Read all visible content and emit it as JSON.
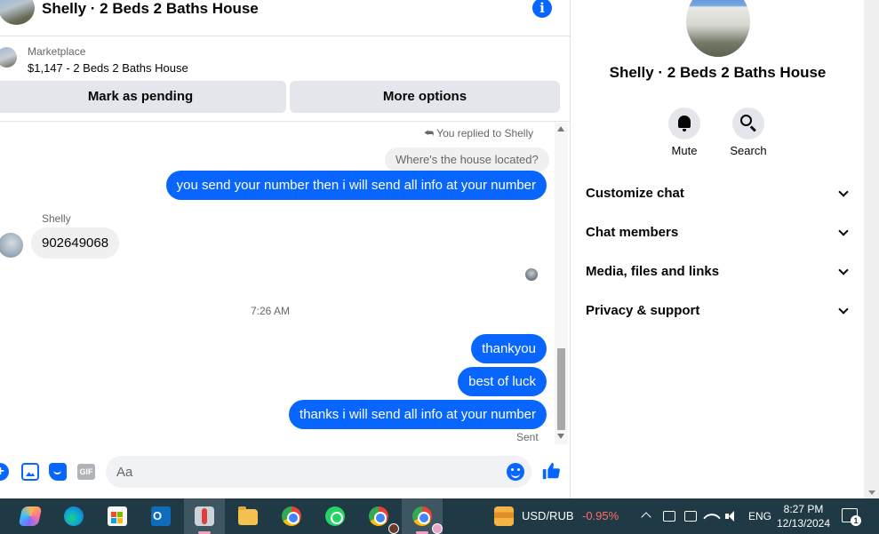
{
  "header": {
    "title": "Shelly · 2 Beds 2 Baths House"
  },
  "marketplace": {
    "label": "Marketplace",
    "listing": "$1,147 - 2 Beds 2 Baths House",
    "mark_pending": "Mark as pending",
    "more_options": "More options"
  },
  "messages": {
    "replied_note": "You replied to Shelly",
    "quoted": "Where's the house located?",
    "out_1": "you send your number then i will send all info at your number",
    "sender_name": "Shelly",
    "in_1": "902649068",
    "timestamp": "7:26 AM",
    "out_2": "thankyou",
    "out_3": "best of luck",
    "out_4": "thanks i will send all info at your number",
    "status": "Sent"
  },
  "composer": {
    "placeholder": "Aa",
    "gif_label": "GIF"
  },
  "panel": {
    "title": "Shelly · 2 Beds 2 Baths House",
    "actions": [
      {
        "label": "Mute",
        "icon": "bell-icon"
      },
      {
        "label": "Search",
        "icon": "search-icon"
      }
    ],
    "sections": [
      {
        "label": "Customize chat"
      },
      {
        "label": "Chat members"
      },
      {
        "label": "Media, files and links"
      },
      {
        "label": "Privacy & support"
      }
    ]
  },
  "taskbar": {
    "apps": [
      "copilot-icon",
      "edge-icon",
      "store-icon",
      "outlook-icon",
      "photoshop-icon",
      "file-explorer-icon",
      "chrome-icon",
      "whatsapp-icon",
      "chrome-profile-icon",
      "chrome-profile-icon"
    ],
    "ticker_label": "USD/RUB",
    "ticker_change": "-0.95%",
    "language": "ENG",
    "time": "8:27 PM",
    "date": "12/13/2024",
    "notifications": "1"
  },
  "colors": {
    "accent": "#0866ff",
    "bubble_in": "#f0f0f0",
    "taskbar": "#1f3a45",
    "negative": "#ff6b6b"
  }
}
